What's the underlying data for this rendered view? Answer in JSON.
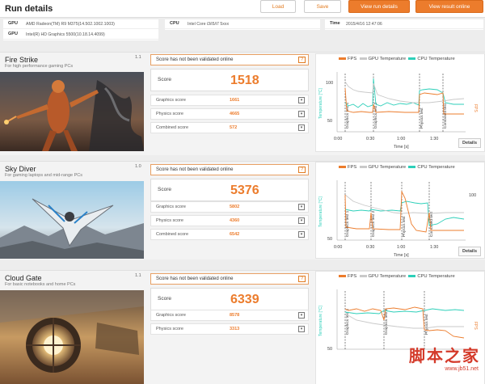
{
  "window": {
    "title": "Run details"
  },
  "toolbar": {
    "load_label": "Load",
    "save_label": "Save",
    "view_run_label": "View run details",
    "view_result_label": "View result online"
  },
  "info": {
    "gpu_label": "GPU",
    "gpu1": "AMD Radeon(TM) R9 M375(14.502.1002.1003)",
    "gpu2_label": "GPU",
    "gpu2": "Intel(R) HD Graphics 5500(10.18.14.4099)",
    "cpu_label": "CPU",
    "cpu": "Intel Core i3/i5/i7 5xxx",
    "time_label": "Time",
    "time": "2015/4/16 12:47:06"
  },
  "colors": {
    "fps": "#ec7c2c",
    "gpu_temp": "#c9c9c9",
    "cpu_temp": "#2dcfb9",
    "accent": "#ec7c2c"
  },
  "tests": [
    {
      "name": "Fire Strike",
      "desc": "For high performance gaming PCs",
      "version": "1.1",
      "validation": "Score has not been validated online",
      "score_label": "Score",
      "score": "1518",
      "subs": [
        {
          "label": "Graphics score",
          "value": "1661"
        },
        {
          "label": "Physics score",
          "value": "4665"
        },
        {
          "label": "Combined score",
          "value": "572"
        }
      ],
      "legend": {
        "fps": "FPS",
        "gpu": "GPU Temperature",
        "cpu": "CPU Temperature"
      },
      "y_left_label": "Temperature [°C]",
      "y_right_label": "FPS",
      "y_ticks": [
        "100",
        "50"
      ],
      "y_right_ticks": [],
      "x_ticks": [
        "0:00",
        "0:30",
        "1:00",
        "1:30"
      ],
      "x_label": "Time [s]",
      "markers": [
        "Graphics test 1",
        "Graphics test 2",
        "Physics test",
        "Combined test"
      ],
      "details_label": "Details"
    },
    {
      "name": "Sky Diver",
      "desc": "For gaming laptops and mid-range PCs",
      "version": "1.0",
      "validation": "Score has not been validated online",
      "score_label": "Score",
      "score": "5376",
      "subs": [
        {
          "label": "Graphics score",
          "value": "5802"
        },
        {
          "label": "Physics score",
          "value": "4360"
        },
        {
          "label": "Combined score",
          "value": "6542"
        }
      ],
      "legend": {
        "fps": "FPS",
        "gpu": "GPU Temperature",
        "cpu": "CPU Temperature"
      },
      "y_left_label": "Temperature [°C]",
      "y_right_label": "",
      "y_ticks": [
        "50"
      ],
      "y_right_ticks": [
        "100"
      ],
      "x_ticks": [
        "0:00",
        "0:30",
        "1:00",
        "1:30"
      ],
      "x_label": "Time [s]",
      "markers": [
        "Graphics test 1",
        "Graphics test 2",
        "Physics test",
        "Combined test"
      ],
      "details_label": "Details"
    },
    {
      "name": "Cloud Gate",
      "desc": "For basic notebooks and home PCs",
      "version": "1.1",
      "validation": "Score has not been validated online",
      "score_label": "Score",
      "score": "6339",
      "subs": [
        {
          "label": "Graphics score",
          "value": "8578"
        },
        {
          "label": "Physics score",
          "value": "3313"
        }
      ],
      "legend": {
        "fps": "FPS",
        "gpu": "GPU Temperature",
        "cpu": "CPU Temperature"
      },
      "y_left_label": "Temperature [°C]",
      "y_right_label": "FPS",
      "y_ticks": [
        "50"
      ],
      "y_right_ticks": [],
      "x_ticks": [],
      "x_label": "",
      "markers": [
        "Graphics test 1",
        "Graphics test 2",
        "Physics test"
      ],
      "details_label": ""
    }
  ],
  "watermark": {
    "text": "脚本之家",
    "url": "www.jb51.net"
  }
}
